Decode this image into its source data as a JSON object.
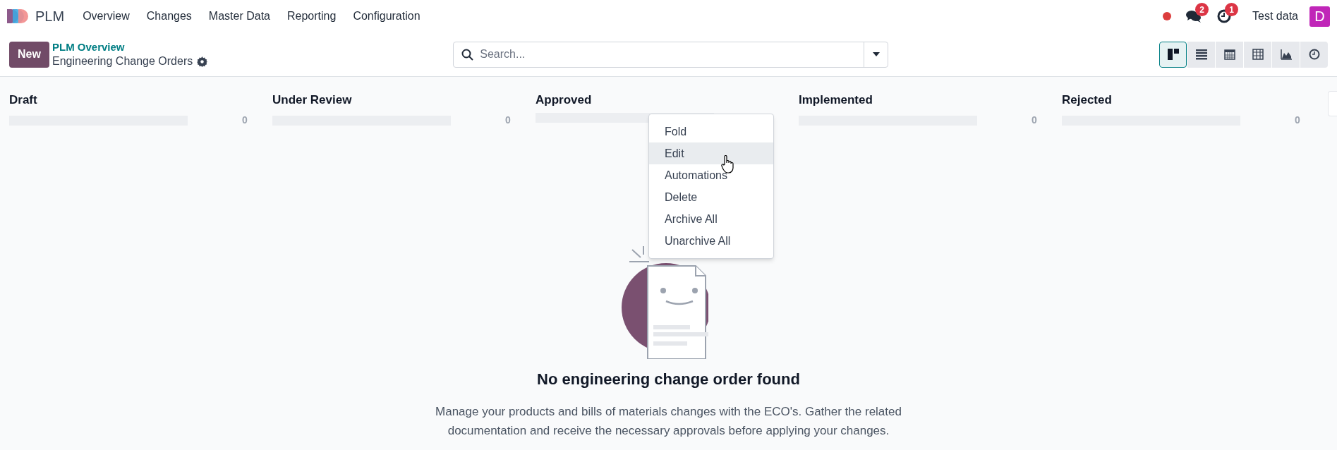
{
  "app": {
    "name": "PLM"
  },
  "menu": [
    "Overview",
    "Changes",
    "Master Data",
    "Reporting",
    "Configuration"
  ],
  "systray": {
    "messages_badge": "2",
    "activities_badge": "1",
    "company": "Test data",
    "avatar": "D"
  },
  "control_panel": {
    "new_button": "New",
    "breadcrumb": "PLM Overview",
    "title": "Engineering Change Orders",
    "search": {
      "placeholder": "Search..."
    },
    "views": [
      {
        "kind": "kanban",
        "selected": true
      },
      {
        "kind": "list",
        "selected": false
      },
      {
        "kind": "calendar",
        "selected": false
      },
      {
        "kind": "pivot",
        "selected": false
      },
      {
        "kind": "graph",
        "selected": false
      },
      {
        "kind": "activity",
        "selected": false
      }
    ]
  },
  "columns": [
    {
      "title": "Draft",
      "count": "0"
    },
    {
      "title": "Under Review",
      "count": "0"
    },
    {
      "title": "Approved"
    },
    {
      "title": "Implemented",
      "count": "0"
    },
    {
      "title": "Rejected",
      "count": "0"
    }
  ],
  "column_menu": [
    {
      "label": "Fold",
      "selected": false
    },
    {
      "label": "Edit",
      "selected": true
    },
    {
      "label": "Automations",
      "selected": false
    },
    {
      "label": "Delete",
      "selected": false
    },
    {
      "label": "Archive All",
      "selected": false
    },
    {
      "label": "Unarchive All",
      "selected": false
    }
  ],
  "empty_state": {
    "title": "No engineering change order found",
    "text": "Manage your products and bills of materials changes with the ECO's. Gather the related documentation and receive the necessary approvals before applying your changes."
  }
}
